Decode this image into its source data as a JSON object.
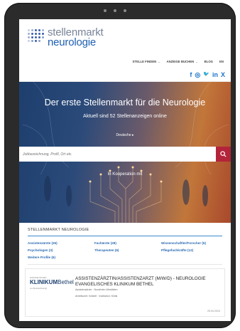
{
  "brand": {
    "logo_top": "stellenmarkt",
    "logo_bottom": "neurologie"
  },
  "nav": {
    "items": [
      {
        "label": "STELLE FINDEN",
        "has_dropdown": true
      },
      {
        "label": "ANZEIGE BUCHEN",
        "has_dropdown": true
      },
      {
        "label": "BLOG",
        "has_dropdown": false
      },
      {
        "label": "EN",
        "has_dropdown": false
      }
    ]
  },
  "social": {
    "icons": [
      "facebook-icon",
      "instagram-icon",
      "twitter-icon",
      "linkedin-icon",
      "xing-icon"
    ],
    "glyphs": [
      "f",
      "◎",
      "🐦",
      "in",
      "X"
    ],
    "color": "#1a73c9"
  },
  "hero": {
    "title": "Der erste Stellenmarkt für die Neurologie",
    "subtitle": "Aktuell sind 52 Stellenanzeigen online",
    "language": "Deutsche ▸",
    "search_placeholder": "Jobbezeichnung, Profil, Ort etc.",
    "cooperation": "In Kooperation mit"
  },
  "categories": {
    "heading": "STELLENMARKT NEUROLOGIE",
    "items": [
      "Assistenzärzte (26)",
      "Fachärzte (28)",
      "Wissenschaftler/Forscher (5)",
      "Psychologen (3)",
      "Therapeuten (6)",
      "Pflegefachkräfte (12)",
      "Weitere Profile (6)"
    ]
  },
  "job": {
    "logo_top": "EVANGELISCHES",
    "logo_main": "KLINIKUM",
    "logo_main_suffix": "Bethel",
    "logo_sub": "von Bodelschwingh",
    "title": "ASSISTENZÄRZTIN/ASSISTENZARZT (M/W/D) - NEUROLOGIE EVANGELISCHES KLINIKUM BETHEL",
    "meta1": "Assistenzärzte · Nordrhein-Westfalen",
    "meta2": "Arbeitszeit: Vollzeit · Institution: Klinik",
    "date": "25.04.2024"
  },
  "colors": {
    "accent": "#b3243a",
    "link": "#2a6bb3",
    "brand": "#1f5fb0"
  }
}
